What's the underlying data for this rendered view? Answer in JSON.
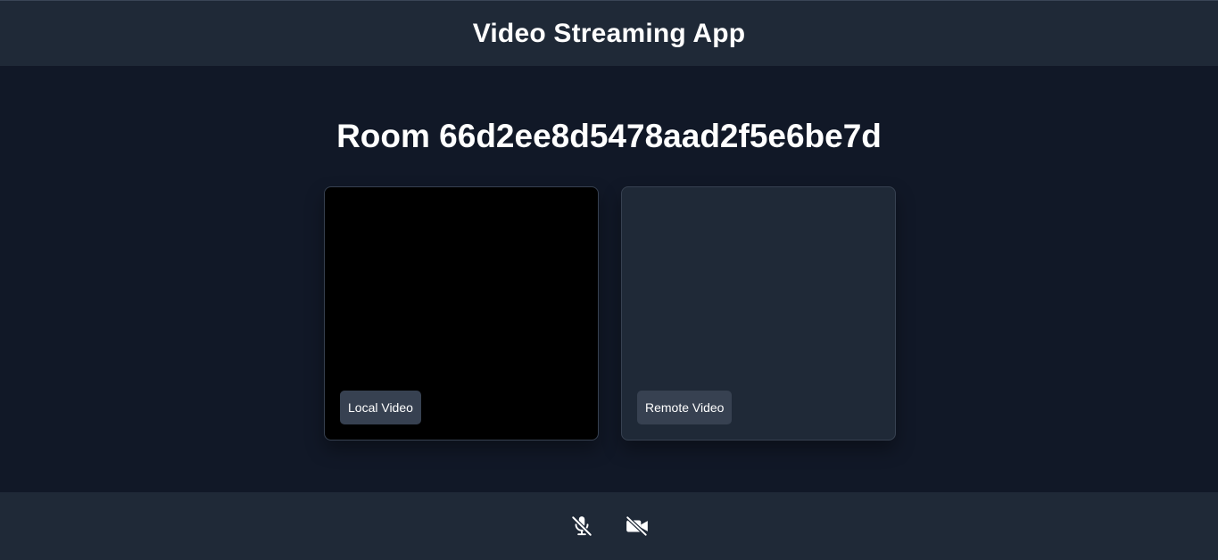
{
  "header": {
    "title": "Video Streaming App"
  },
  "room": {
    "title": "Room 66d2ee8d5478aad2f5e6be7d"
  },
  "videos": {
    "local": {
      "label": "Local Video"
    },
    "remote": {
      "label": "Remote Video"
    }
  },
  "controls": {
    "mic": {
      "icon": "microphone-slash-icon",
      "state": "muted"
    },
    "camera": {
      "icon": "video-slash-icon",
      "state": "off"
    }
  },
  "colors": {
    "background": "#111827",
    "bar": "#1f2937",
    "label_bg": "#374151",
    "local_video_bg": "#000000"
  }
}
